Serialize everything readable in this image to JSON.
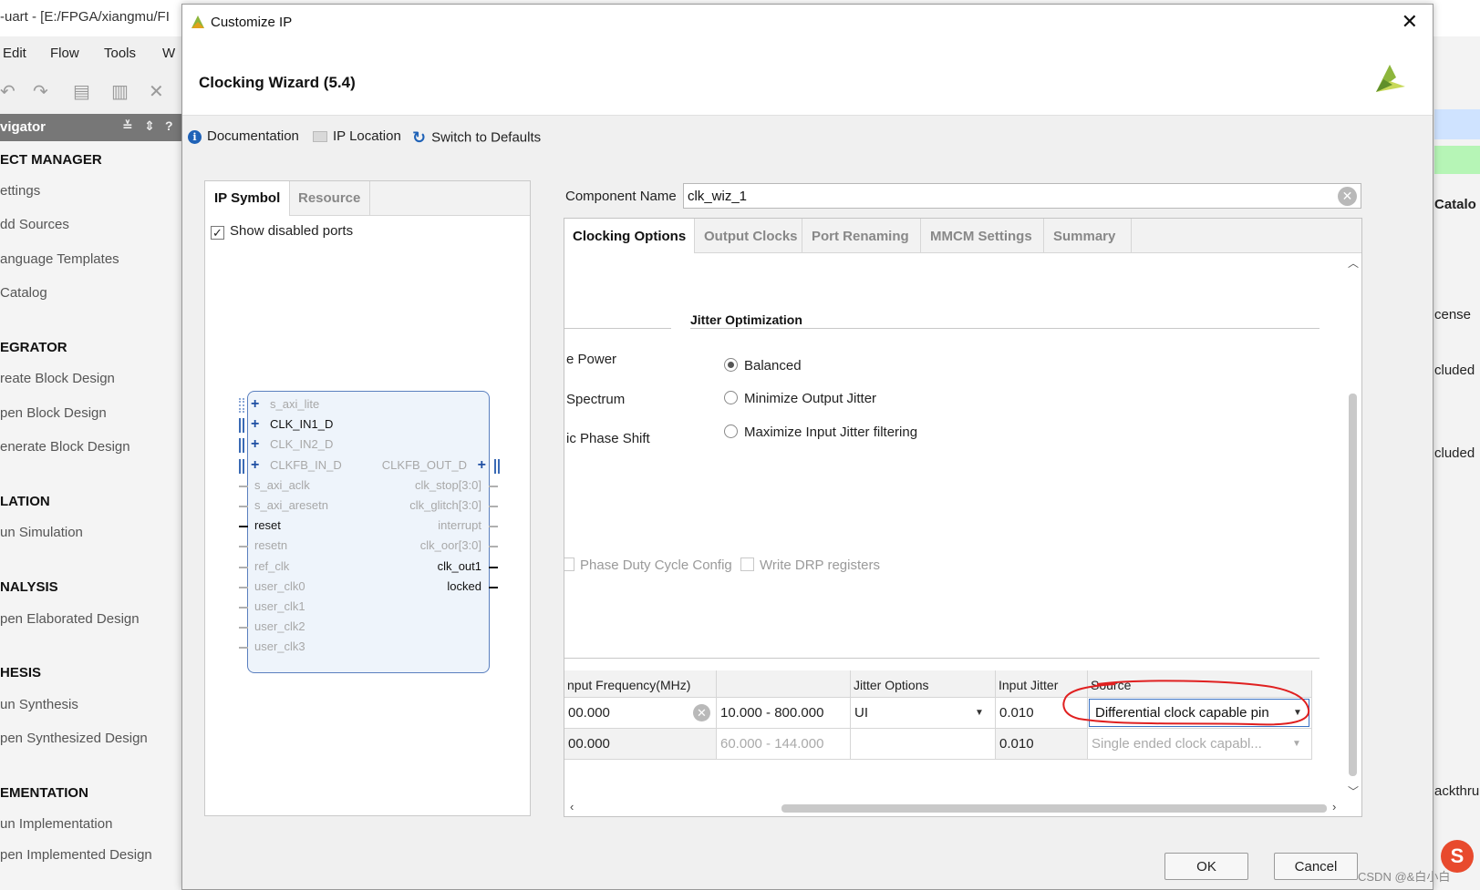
{
  "bg_window": {
    "title": "-uart - [E:/FPGA/xiangmu/FI",
    "menu": [
      "Edit",
      "Flow",
      "Tools",
      "W"
    ],
    "navigator_title": "vigator",
    "flow_navigator": [
      {
        "text": "ECT MANAGER",
        "kind": "sec"
      },
      {
        "text": "ettings",
        "kind": "itm"
      },
      {
        "text": "dd Sources",
        "kind": "itm"
      },
      {
        "text": "anguage Templates",
        "kind": "itm"
      },
      {
        "text": " Catalog",
        "kind": "itm"
      },
      {
        "text": "EGRATOR",
        "kind": "sec"
      },
      {
        "text": "reate Block Design",
        "kind": "itm"
      },
      {
        "text": "pen Block Design",
        "kind": "itm"
      },
      {
        "text": "enerate Block Design",
        "kind": "itm"
      },
      {
        "text": "LATION",
        "kind": "sec"
      },
      {
        "text": "un Simulation",
        "kind": "itm"
      },
      {
        "text": "NALYSIS",
        "kind": "sec"
      },
      {
        "text": "pen Elaborated Design",
        "kind": "itm"
      },
      {
        "text": "HESIS",
        "kind": "sec"
      },
      {
        "text": "un Synthesis",
        "kind": "itm"
      },
      {
        "text": "pen Synthesized Design",
        "kind": "itm"
      },
      {
        "text": "EMENTATION",
        "kind": "sec"
      },
      {
        "text": "un Implementation",
        "kind": "itm"
      },
      {
        "text": "pen Implemented Design",
        "kind": "itm"
      }
    ],
    "right_strip": [
      "Catalo",
      "cense",
      "cluded",
      "cluded",
      "ackthru"
    ],
    "watermark": "CSDN @&白小白",
    "ime_icon": "S"
  },
  "dialog": {
    "title": "Customize IP",
    "close": "✕",
    "wizard_title": "Clocking Wizard (5.4)",
    "toolbar": {
      "documentation": "Documentation",
      "ip_location": "IP Location",
      "switch_defaults": "Switch to Defaults"
    },
    "left_tabs": {
      "ip_symbol": "IP Symbol",
      "resource": "Resource"
    },
    "show_disabled_ports": "Show disabled ports",
    "ip_ports_left": [
      {
        "name": "s_axi_lite",
        "enabled": false,
        "bus": true
      },
      {
        "name": "CLK_IN1_D",
        "enabled": true,
        "bus": true
      },
      {
        "name": "CLK_IN2_D",
        "enabled": false,
        "bus": true
      },
      {
        "name": "CLKFB_IN_D",
        "enabled": false,
        "bus": true
      },
      {
        "name": "s_axi_aclk",
        "enabled": false,
        "bus": false
      },
      {
        "name": "s_axi_aresetn",
        "enabled": false,
        "bus": false
      },
      {
        "name": "reset",
        "enabled": true,
        "bus": false
      },
      {
        "name": "resetn",
        "enabled": false,
        "bus": false
      },
      {
        "name": "ref_clk",
        "enabled": false,
        "bus": false
      },
      {
        "name": "user_clk0",
        "enabled": false,
        "bus": false
      },
      {
        "name": "user_clk1",
        "enabled": false,
        "bus": false
      },
      {
        "name": "user_clk2",
        "enabled": false,
        "bus": false
      },
      {
        "name": "user_clk3",
        "enabled": false,
        "bus": false
      }
    ],
    "ip_ports_right": [
      {
        "name": "CLKFB_OUT_D",
        "enabled": false,
        "bus": true,
        "row": 3
      },
      {
        "name": "clk_stop[3:0]",
        "enabled": false,
        "bus": false,
        "row": 4
      },
      {
        "name": "clk_glitch[3:0]",
        "enabled": false,
        "bus": false,
        "row": 5
      },
      {
        "name": "interrupt",
        "enabled": false,
        "bus": false,
        "row": 6
      },
      {
        "name": "clk_oor[3:0]",
        "enabled": false,
        "bus": false,
        "row": 7
      },
      {
        "name": "clk_out1",
        "enabled": true,
        "bus": false,
        "row": 8
      },
      {
        "name": "locked",
        "enabled": true,
        "bus": false,
        "row": 9
      }
    ],
    "component_name_label": "Component Name",
    "component_name_value": "clk_wiz_1",
    "tabs": [
      "Clocking Options",
      "Output Clocks",
      "Port Renaming",
      "MMCM Settings",
      "Summary"
    ],
    "jitter_optimization": {
      "title": "Jitter Optimization",
      "options": [
        "Balanced",
        "Minimize Output Jitter",
        "Maximize Input Jitter filtering"
      ],
      "selected": "Balanced"
    },
    "cut_labels": [
      "e Power",
      " Spectrum",
      "ic Phase Shift"
    ],
    "disabled_checks": [
      "Phase Duty Cycle Config",
      "Write DRP registers"
    ],
    "input_clock_table": {
      "headers": [
        "nput Frequency(MHz)",
        "",
        "Jitter Options",
        "Input Jitter",
        "Source"
      ],
      "rows": [
        {
          "freq": "00.000",
          "range": "10.000 - 800.000",
          "jitter_opt": "UI",
          "jitter": "0.010",
          "source": "Differential clock capable pin"
        },
        {
          "freq": "00.000",
          "range": "60.000 - 144.000",
          "jitter_opt": "",
          "jitter": "0.010",
          "source": "Single ended clock capabl..."
        }
      ]
    },
    "buttons": {
      "ok": "OK",
      "cancel": "Cancel"
    }
  },
  "colors": {
    "accent_blue": "#1f62b7",
    "annotation_red": "#e02020",
    "nav_header": "#777777",
    "xilinx_logo_green": "#8db63c"
  }
}
